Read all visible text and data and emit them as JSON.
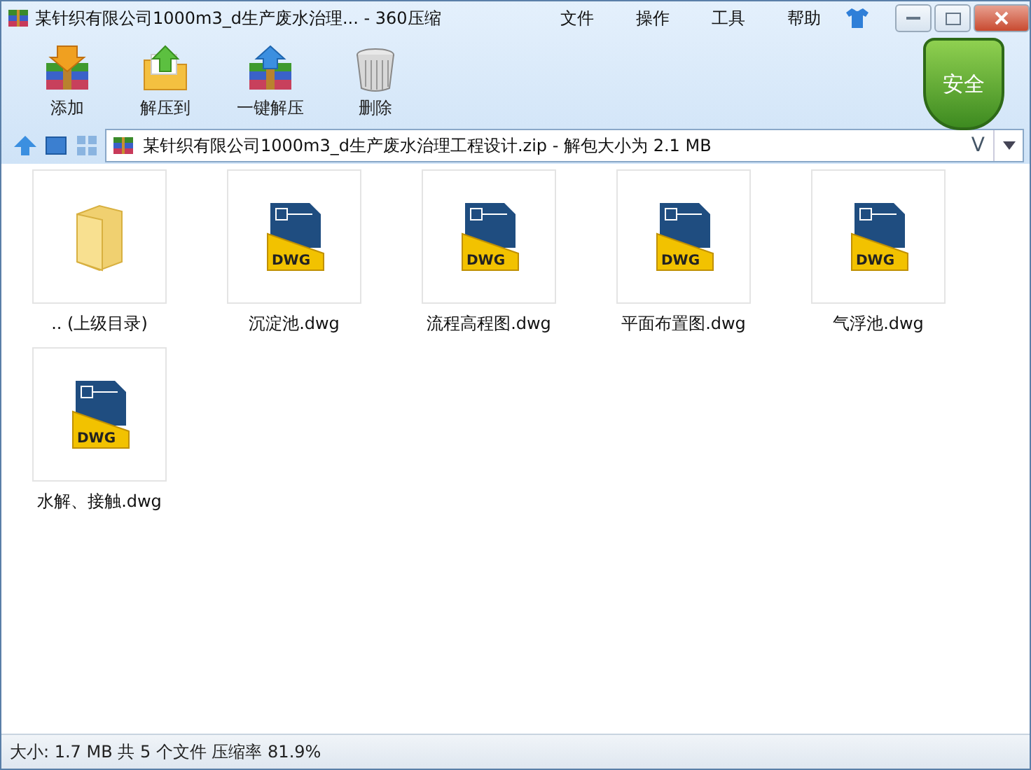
{
  "window": {
    "title": "某针织有限公司1000m3_d生产废水治理... - 360压缩"
  },
  "menu": [
    "文件",
    "操作",
    "工具",
    "帮助"
  ],
  "toolbar": [
    {
      "kind": "add",
      "label": "添加"
    },
    {
      "kind": "extract",
      "label": "解压到"
    },
    {
      "kind": "oneclick",
      "label": "一键解压"
    },
    {
      "kind": "delete",
      "label": "删除"
    }
  ],
  "security_badge": "安全",
  "address": {
    "value": "某针织有限公司1000m3_d生产废水治理工程设计.zip - 解包大小为 2.1 MB",
    "dropdown_glyph": "V"
  },
  "files": [
    {
      "kind": "folder",
      "name": ".. (上级目录)"
    },
    {
      "kind": "dwg",
      "name": "沉淀池.dwg",
      "badge": "DWG"
    },
    {
      "kind": "dwg",
      "name": "流程高程图.dwg",
      "badge": "DWG"
    },
    {
      "kind": "dwg",
      "name": "平面布置图.dwg",
      "badge": "DWG"
    },
    {
      "kind": "dwg",
      "name": "气浮池.dwg",
      "badge": "DWG"
    },
    {
      "kind": "dwg",
      "name": "水解、接触.dwg",
      "badge": "DWG"
    }
  ],
  "status_bar": "大小: 1.7 MB 共 5 个文件 压缩率 81.9%"
}
